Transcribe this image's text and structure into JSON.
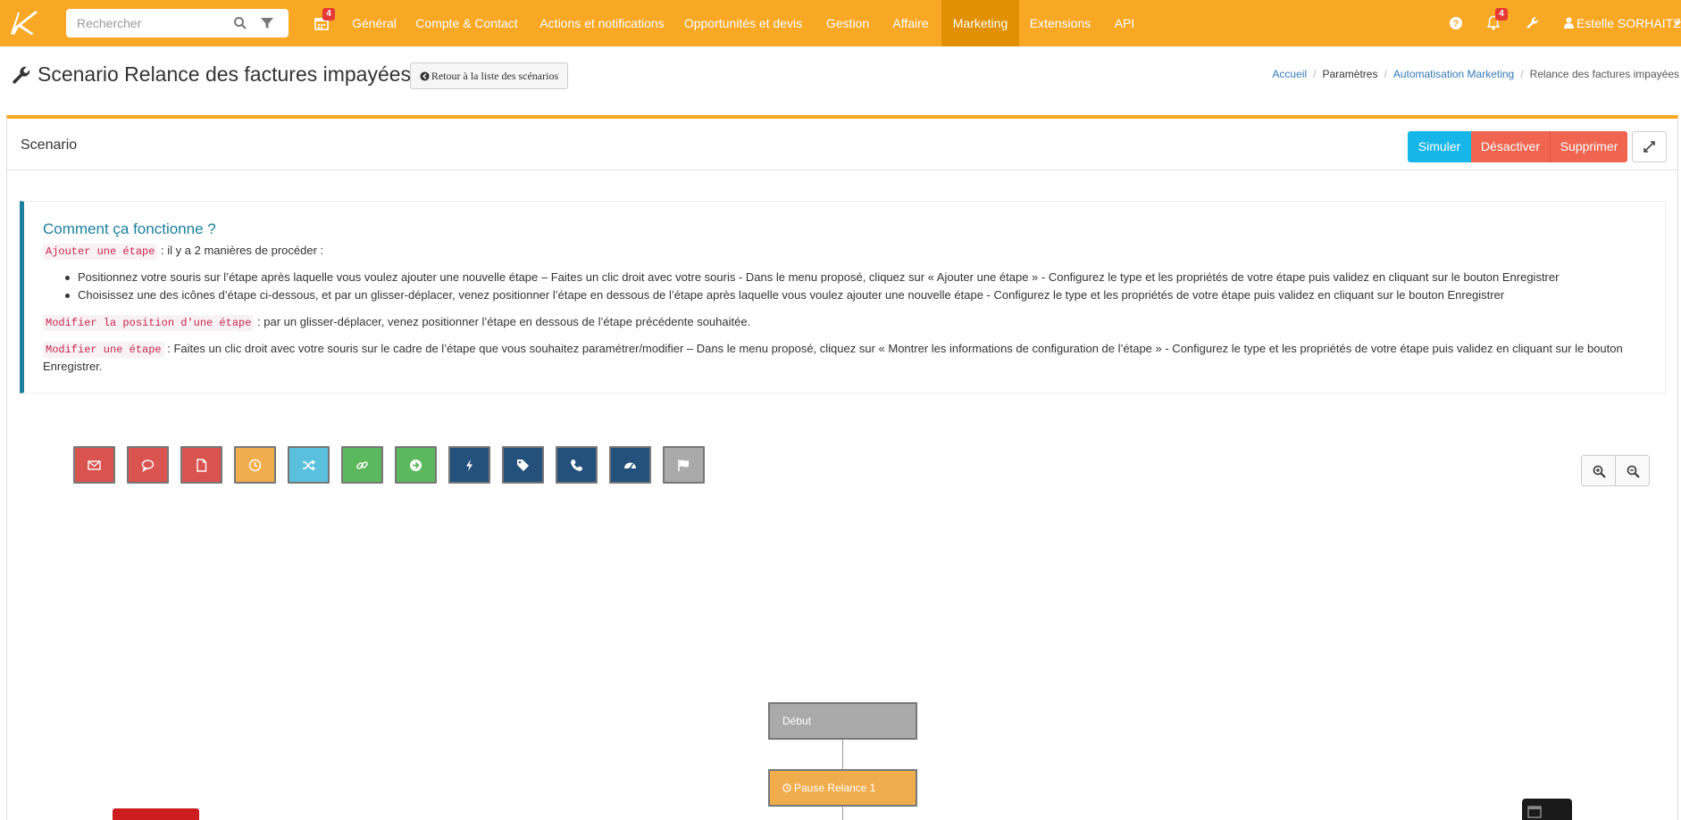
{
  "navbar": {
    "search_placeholder": "Rechercher",
    "calendar_badge": "4",
    "menu": [
      "Général",
      "Compte & Contact",
      "Actions et notifications",
      "Opportunités et devis",
      "Gestion",
      "Affaire",
      "Marketing",
      "Extensions",
      "API"
    ],
    "active_menu": "Marketing",
    "notifications_badge": "4",
    "user_name": "Estelle SORHAITZ"
  },
  "page": {
    "title": "Scenario Relance des factures impayées",
    "back_label": "Retour à la liste des scénarios"
  },
  "breadcrumb": [
    "Accueil",
    "Paramètres",
    "Automatisation Marketing",
    "Relance des factures impayées"
  ],
  "panel": {
    "title": "Scenario",
    "simulate_label": "Simuler",
    "disable_label": "Désactiver",
    "delete_label": "Supprimer"
  },
  "help": {
    "title": "Comment ça fonctionne ?",
    "add_code": "Ajouter une étape",
    "add_text": " : il y a 2 manières de procéder :",
    "bullet1": "Positionnez votre souris sur l’étape après laquelle vous voulez ajouter une nouvelle étape – Faites un clic droit avec votre souris - Dans le menu proposé, cliquez sur « Ajouter une étape » - Configurez le type et les propriétés de votre étape puis validez en cliquant sur le bouton Enregistrer",
    "bullet2": "Choisissez une des icônes d’étape ci-dessous, et par un glisser-déplacer, venez positionner l’étape en dessous de l’étape après laquelle vous voulez ajouter une nouvelle étape - Configurez le type et les propriétés de votre étape puis validez en cliquant sur le bouton Enregistrer",
    "move_code": "Modifier la position d'une étape",
    "move_text": " : par un glisser-déplacer, venez positionner l’étape en dessous de l’étape précédente souhaitée.",
    "edit_code": "Modifier une étape",
    "edit_text": " : Faites un clic droit avec votre souris sur le cadre de l’étape que vous souhaitez paramétrer/modifier – Dans le menu proposé, cliquez sur « Montrer les informations de configuration de l’étape » - Configurez le type et les propriétés de votre étape puis validez en cliquant sur le bouton",
    "edit_text2": "Enregistrer."
  },
  "step_types": [
    {
      "icon": "envelope-icon",
      "color": "#d9534f"
    },
    {
      "icon": "comment-icon",
      "color": "#d9534f"
    },
    {
      "icon": "file-icon",
      "color": "#d9534f"
    },
    {
      "icon": "clock-icon",
      "color": "#f0ad4e"
    },
    {
      "icon": "random-icon",
      "color": "#5bc0de"
    },
    {
      "icon": "link-icon",
      "color": "#5cb85c"
    },
    {
      "icon": "arrow-circle-right-icon",
      "color": "#5cb85c"
    },
    {
      "icon": "bolt-icon",
      "color": "#24517c"
    },
    {
      "icon": "tag-icon",
      "color": "#24517c"
    },
    {
      "icon": "phone-icon",
      "color": "#24517c"
    },
    {
      "icon": "dashboard-icon",
      "color": "#24517c"
    },
    {
      "icon": "flag-icon",
      "color": "#aaaaaa"
    }
  ],
  "flow": {
    "start_label": "Début",
    "pause_label": "Pause Relance 1"
  },
  "colors": {
    "brand": "#f9a826",
    "brand_active": "#e09000",
    "simulate": "#17b6e8",
    "danger": "#f0654f",
    "callout_accent": "#1b809e"
  }
}
